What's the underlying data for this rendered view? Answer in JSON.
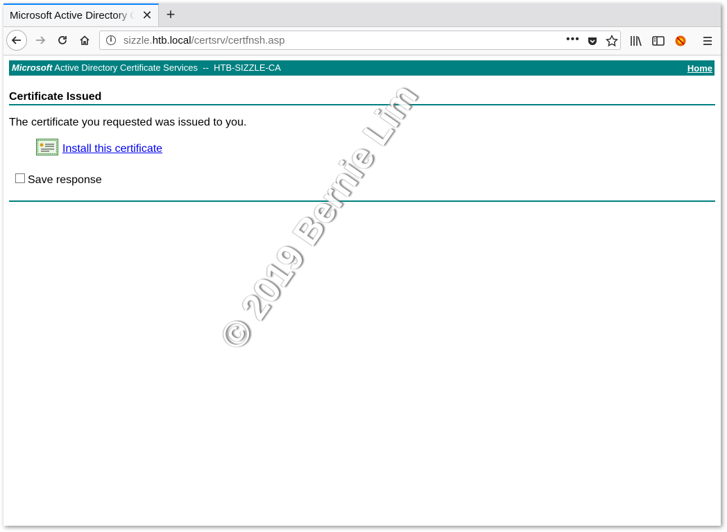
{
  "browser": {
    "tab": {
      "title": "Microsoft Active Directory Certificate Services",
      "close_icon": "close-icon"
    },
    "new_tab_icon": "plus-icon",
    "url": {
      "host_prefix": "sizzle.",
      "host": "htb.local",
      "path": "/certsrv/certfnsh.asp"
    },
    "icons": [
      "back-arrow-icon",
      "forward-arrow-icon",
      "reload-icon",
      "home-icon",
      "info-icon",
      "more-dots-icon",
      "pocket-icon",
      "star-icon",
      "library-icon",
      "sidebar-icon",
      "extension-icon",
      "hamburger-menu-icon"
    ]
  },
  "page": {
    "banner": {
      "brand": "Microsoft",
      "service": "Active Directory Certificate Services",
      "separator": "--",
      "ca_name": "HTB-SIZZLE-CA",
      "home_link": "Home"
    },
    "heading": "Certificate Issued",
    "message": "The certificate you requested was issued to you.",
    "install_link": "Install this certificate",
    "save_response_label": "Save response",
    "save_response_checked": false,
    "watermark": "© 2019 Bernie Lim"
  },
  "colors": {
    "banner": "#008080",
    "link": "#0000ee",
    "tab_accent": "#0a84ff"
  }
}
